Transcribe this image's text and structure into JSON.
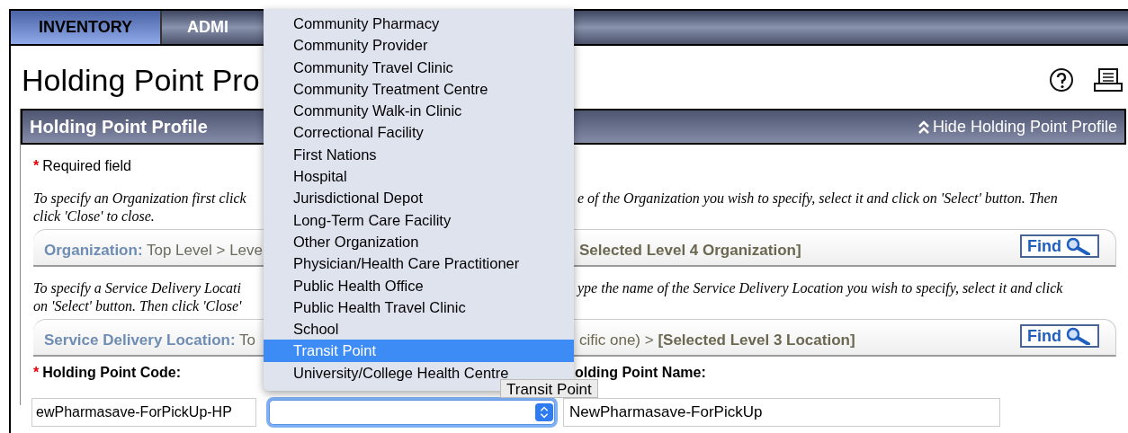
{
  "nav_tabs": [
    {
      "label": "INVENTORY",
      "selected": true
    },
    {
      "label": "ADMI",
      "selected": false
    }
  ],
  "page_title": "Holding Point Pro",
  "panel": {
    "title": "Holding Point Profile",
    "toggle": "Hide Holding Point Profile"
  },
  "required_note": {
    "marker": "*",
    "text": "Required field"
  },
  "organization": {
    "instructions": [
      {
        "left": "To specify an Organization first click",
        "right": "e of the Organization you wish to specify, select it and click on 'Select' button. Then"
      },
      {
        "left": "click 'Close' to close."
      }
    ],
    "label": "Organization:",
    "path_left": "Top Level > Leve",
    "path_right": "**Selected Level 4 Organization]**",
    "find_button": "Find"
  },
  "service_delivery_location": {
    "instructions": [
      {
        "left": "To specify a Service Delivery Locati",
        "right": "ype the name of the Service Delivery Location you wish to specify, select it and click"
      },
      {
        "left": "on 'Select' button. Then click 'Close'"
      }
    ],
    "label": "Service Delivery Location:",
    "path_left": "To",
    "path_right": "cific one) > **[Selected Level 3 Location]**",
    "find_button": "Find"
  },
  "code_field": {
    "label": "Holding Point Code:",
    "required": true,
    "value": "ewPharmasave-ForPickUp-HP"
  },
  "type_select": {
    "focused": true
  },
  "name_field": {
    "label": "olding Point Name:",
    "value": "NewPharmasave-ForPickUp"
  },
  "dropdown": {
    "options": [
      {
        "label": "Community Pharmacy",
        "selected": false
      },
      {
        "label": "Community Provider",
        "selected": false
      },
      {
        "label": "Community Travel Clinic",
        "selected": false
      },
      {
        "label": "Community Treatment Centre",
        "selected": false
      },
      {
        "label": "Community Walk-in Clinic",
        "selected": false
      },
      {
        "label": "Correctional Facility",
        "selected": false
      },
      {
        "label": "First Nations",
        "selected": false
      },
      {
        "label": "Hospital",
        "selected": false
      },
      {
        "label": "Jurisdictional Depot",
        "selected": false
      },
      {
        "label": "Long-Term Care Facility",
        "selected": false
      },
      {
        "label": "Other Organization",
        "selected": false
      },
      {
        "label": "Physician/Health Care Practitioner",
        "selected": false
      },
      {
        "label": "Public Health Office",
        "selected": false
      },
      {
        "label": "Public Health Travel Clinic",
        "selected": false
      },
      {
        "label": "School",
        "selected": false
      },
      {
        "label": "Transit Point",
        "selected": true
      },
      {
        "label": "University/College Health Centre",
        "selected": false
      }
    ]
  },
  "tooltip": "Transit Point"
}
